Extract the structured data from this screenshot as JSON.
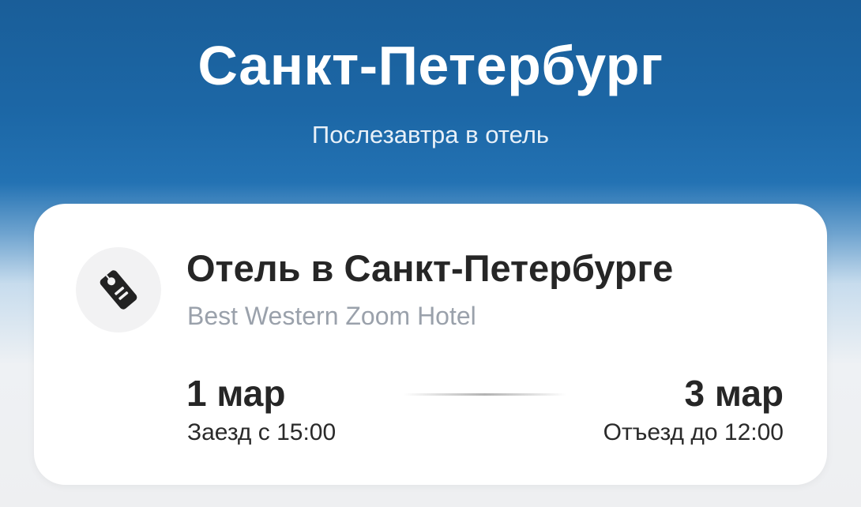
{
  "header": {
    "city": "Санкт-Петербург",
    "subtitle": "Послезавтра в отель"
  },
  "booking": {
    "icon": "door-hanger-icon",
    "title": "Отель в Санкт-Петербурге",
    "hotel": "Best Western Zoom Hotel",
    "checkin": {
      "date": "1 мар",
      "time": "Заезд с 15:00"
    },
    "checkout": {
      "date": "3 мар",
      "time": "Отъезд до 12:00"
    }
  },
  "colors": {
    "header_blue": "#1c67a6",
    "card": "#ffffff",
    "primary_text": "#262626",
    "secondary_text": "#9aa1ab",
    "icon_circle": "#f2f2f3"
  }
}
